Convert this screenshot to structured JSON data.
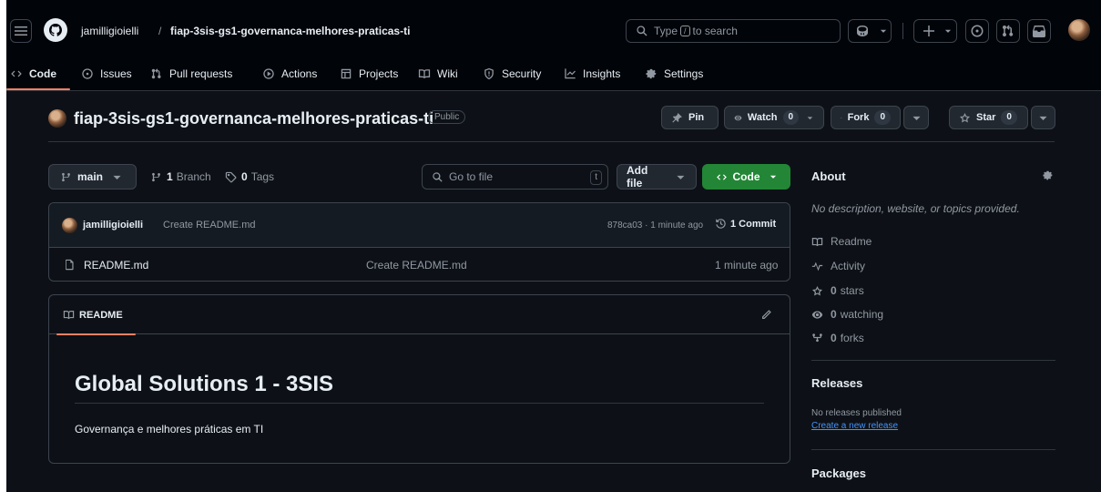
{
  "header": {
    "owner": "jamilligioielli",
    "separator": "/",
    "repo": "fiap-3sis-gs1-governanca-melhores-praticas-ti",
    "search_prefix": "Type",
    "search_key": "/",
    "search_suffix": "to search"
  },
  "nav": {
    "items": [
      {
        "label": "Code"
      },
      {
        "label": "Issues"
      },
      {
        "label": "Pull requests"
      },
      {
        "label": "Actions"
      },
      {
        "label": "Projects"
      },
      {
        "label": "Wiki"
      },
      {
        "label": "Security"
      },
      {
        "label": "Insights"
      },
      {
        "label": "Settings"
      }
    ]
  },
  "repo": {
    "title": "fiap-3sis-gs1-governanca-melhores-praticas-ti",
    "visibility": "Public",
    "pin_label": "Pin",
    "watch_label": "Watch",
    "watch_count": "0",
    "fork_label": "Fork",
    "fork_count": "0",
    "star_label": "Star",
    "star_count": "0"
  },
  "toolbar": {
    "branch": "main",
    "branch_count": "1",
    "branch_word": "Branch",
    "tag_count": "0",
    "tag_word": "Tags",
    "goto_placeholder": "Go to file",
    "goto_key": "t",
    "add_file": "Add file",
    "code": "Code"
  },
  "commit": {
    "author": "jamilligioielli",
    "message": "Create README.md",
    "hash_time": "878ca03 · 1 minute ago",
    "commits": "1 Commit"
  },
  "files": [
    {
      "name": "README.md",
      "message": "Create README.md",
      "time": "1 minute ago"
    }
  ],
  "readme": {
    "tab": "README",
    "heading": "Global Solutions 1 - 3SIS",
    "body": "Governança e melhores práticas em TI"
  },
  "about": {
    "title": "About",
    "description": "No description, website, or topics provided.",
    "readme": "Readme",
    "activity": "Activity",
    "stars_count": "0",
    "stars_word": "stars",
    "watching_count": "0",
    "watching_word": "watching",
    "forks_count": "0",
    "forks_word": "forks"
  },
  "releases": {
    "title": "Releases",
    "none": "No releases published",
    "create": "Create a new release"
  },
  "packages": {
    "title": "Packages"
  },
  "colors": {
    "accent": "#f78166",
    "green": "#238636",
    "link": "#4493f8"
  }
}
